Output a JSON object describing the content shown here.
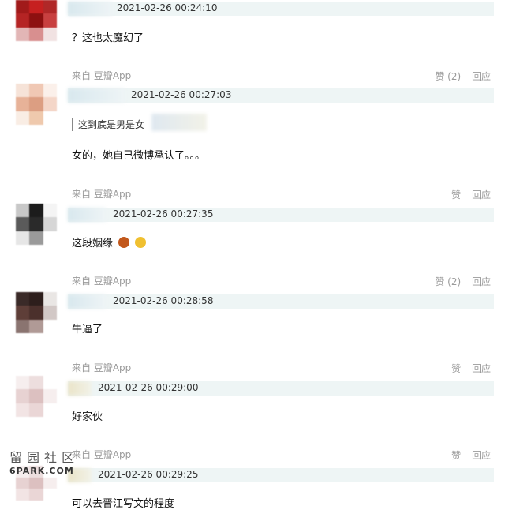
{
  "comments": [
    {
      "time": "2021-02-26 00:24:10",
      "text": "？这也太魔幻了",
      "source": "",
      "likes": "",
      "reply": ""
    },
    {
      "time": "2021-02-26 00:27:03",
      "quote": "这到底是男是女",
      "text": "女的，她自己微博承认了。。。",
      "source": "来自 豆瓣App",
      "likes": "赞 (2)",
      "reply": "回应"
    },
    {
      "time": "2021-02-26 00:27:35",
      "text": "这段姻缘",
      "source": "来自 豆瓣App",
      "likes": "赞",
      "reply": "回应"
    },
    {
      "time": "2021-02-26 00:28:58",
      "text": "牛逼了",
      "source": "来自 豆瓣App",
      "likes": "赞 (2)",
      "reply": "回应"
    },
    {
      "time": "2021-02-26 00:29:00",
      "text": "好家伙",
      "source": "来自 豆瓣App",
      "likes": "赞",
      "reply": "回应"
    },
    {
      "time": "2021-02-26 00:29:25",
      "text": "可以去晋江写文的程度",
      "source": "来自 豆瓣App",
      "likes": "赞",
      "reply": "回应"
    }
  ],
  "watermark": {
    "cn": "留园社区",
    "en": "6PARK.COM"
  }
}
